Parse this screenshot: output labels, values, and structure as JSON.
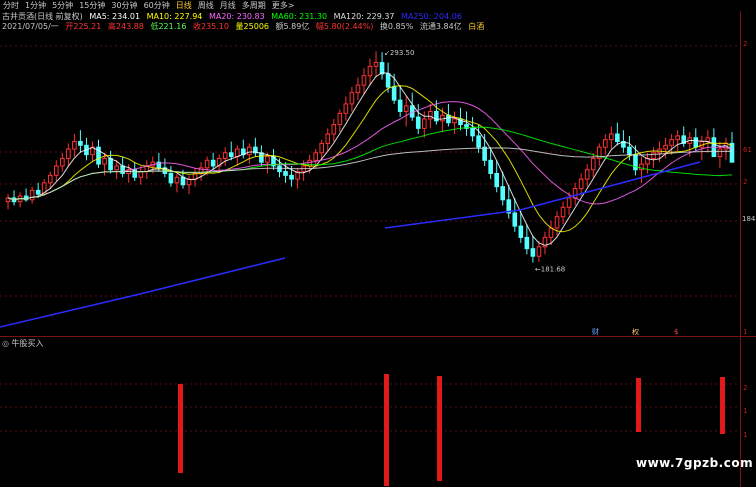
{
  "toolbar": {
    "tabs": [
      "分时",
      "1分钟",
      "5分钟",
      "15分钟",
      "30分钟",
      "60分钟",
      "日线",
      "周线",
      "月线",
      "多周期",
      "更多>"
    ],
    "active_tab": "日线"
  },
  "info": {
    "stock": "古井贡酒(日线 前复权)",
    "ma5": "MA5: 234.01",
    "ma10": "MA10: 227.94",
    "ma20": "MA20: 230.83",
    "ma60": "MA60: 231.30",
    "ma120": "MA120: 229.37",
    "ma250": "MA250: 204.06",
    "date": "2021/07/05/一",
    "open": "开225.21",
    "high": "高243.88",
    "low": "低221.16",
    "close": "收235.10",
    "volume": "量25006",
    "amount": "额5.89亿",
    "change": "幅5.80(2.44%)",
    "turnover": "换0.85%",
    "float": "流通3.84亿",
    "tag": "白酒"
  },
  "annotations": {
    "high_label": "293.50",
    "low_label": "181.68"
  },
  "right_axis": {
    "labels": [
      "2",
      "61",
      "2",
      "184",
      "1"
    ],
    "sub_labels": [
      "2",
      "1",
      "1"
    ]
  },
  "markers": [
    "财",
    "权",
    "$"
  ],
  "sub_panel": {
    "title": "牛股买入"
  },
  "watermark": "www.7gpzb.com",
  "colors": {
    "up": "#ff3232",
    "down": "#54ffff",
    "ma5": "#ffffff",
    "ma10": "#ffff00",
    "ma20": "#ff66ff",
    "ma60": "#00ff00",
    "ma120": "#dddddd",
    "ma250": "#2b2bff",
    "signal": "#e01a1a"
  },
  "chart_data": {
    "type": "candlestick",
    "price_range": [
      175,
      300
    ],
    "candles": [
      [
        214,
        218,
        210,
        216
      ],
      [
        216,
        220,
        212,
        214
      ],
      [
        214,
        219,
        211,
        217
      ],
      [
        217,
        221,
        214,
        215
      ],
      [
        215,
        222,
        213,
        220
      ],
      [
        220,
        224,
        216,
        218
      ],
      [
        218,
        226,
        217,
        224
      ],
      [
        224,
        230,
        221,
        228
      ],
      [
        228,
        236,
        225,
        233
      ],
      [
        233,
        240,
        230,
        237
      ],
      [
        237,
        245,
        233,
        242
      ],
      [
        242,
        250,
        238,
        246
      ],
      [
        246,
        252,
        240,
        244
      ],
      [
        244,
        248,
        236,
        239
      ],
      [
        239,
        246,
        235,
        243
      ],
      [
        243,
        247,
        232,
        234
      ],
      [
        234,
        240,
        228,
        237
      ],
      [
        237,
        241,
        229,
        231
      ],
      [
        231,
        236,
        226,
        233
      ],
      [
        233,
        238,
        227,
        229
      ],
      [
        229,
        234,
        224,
        231
      ],
      [
        231,
        235,
        225,
        227
      ],
      [
        227,
        233,
        223,
        230
      ],
      [
        230,
        236,
        226,
        233
      ],
      [
        233,
        238,
        229,
        235
      ],
      [
        235,
        240,
        230,
        232
      ],
      [
        232,
        237,
        227,
        229
      ],
      [
        229,
        233,
        222,
        224
      ],
      [
        224,
        229,
        219,
        227
      ],
      [
        227,
        231,
        221,
        223
      ],
      [
        223,
        228,
        218,
        226
      ],
      [
        226,
        232,
        222,
        229
      ],
      [
        229,
        235,
        225,
        232
      ],
      [
        232,
        238,
        228,
        236
      ],
      [
        236,
        240,
        231,
        233
      ],
      [
        233,
        239,
        229,
        237
      ],
      [
        237,
        243,
        233,
        240
      ],
      [
        240,
        246,
        236,
        238
      ],
      [
        238,
        244,
        233,
        242
      ],
      [
        242,
        247,
        237,
        239
      ],
      [
        239,
        245,
        234,
        243
      ],
      [
        243,
        248,
        238,
        240
      ],
      [
        240,
        244,
        233,
        235
      ],
      [
        235,
        240,
        229,
        238
      ],
      [
        238,
        242,
        231,
        233
      ],
      [
        233,
        237,
        227,
        230
      ],
      [
        230,
        235,
        224,
        228
      ],
      [
        228,
        233,
        222,
        226
      ],
      [
        226,
        232,
        221,
        230
      ],
      [
        230,
        236,
        225,
        233
      ],
      [
        233,
        239,
        229,
        236
      ],
      [
        236,
        242,
        232,
        240
      ],
      [
        240,
        247,
        236,
        245
      ],
      [
        245,
        253,
        241,
        250
      ],
      [
        250,
        258,
        246,
        255
      ],
      [
        255,
        263,
        251,
        261
      ],
      [
        261,
        270,
        257,
        266
      ],
      [
        266,
        275,
        262,
        272
      ],
      [
        272,
        280,
        268,
        276
      ],
      [
        276,
        285,
        271,
        281
      ],
      [
        281,
        290,
        276,
        286
      ],
      [
        286,
        294,
        280,
        288
      ],
      [
        288,
        293.5,
        279,
        282
      ],
      [
        282,
        288,
        272,
        275
      ],
      [
        275,
        282,
        266,
        268
      ],
      [
        268,
        276,
        259,
        262
      ],
      [
        262,
        270,
        254,
        265
      ],
      [
        265,
        272,
        257,
        259
      ],
      [
        259,
        266,
        250,
        253
      ],
      [
        253,
        262,
        248,
        258
      ],
      [
        258,
        266,
        253,
        262
      ],
      [
        262,
        268,
        255,
        257
      ],
      [
        257,
        264,
        251,
        260
      ],
      [
        260,
        266,
        254,
        256
      ],
      [
        256,
        262,
        250,
        258
      ],
      [
        258,
        264,
        252,
        255
      ],
      [
        255,
        262,
        249,
        253
      ],
      [
        253,
        259,
        246,
        249
      ],
      [
        249,
        255,
        240,
        243
      ],
      [
        243,
        250,
        233,
        236
      ],
      [
        236,
        243,
        226,
        229
      ],
      [
        229,
        236,
        219,
        222
      ],
      [
        222,
        230,
        212,
        215
      ],
      [
        215,
        223,
        205,
        208
      ],
      [
        208,
        216,
        198,
        201
      ],
      [
        201,
        209,
        192,
        195
      ],
      [
        195,
        202,
        186,
        189
      ],
      [
        189,
        196,
        181.68,
        185
      ],
      [
        185,
        193,
        182,
        190
      ],
      [
        190,
        198,
        186,
        195
      ],
      [
        195,
        204,
        191,
        200
      ],
      [
        200,
        209,
        196,
        206
      ],
      [
        206,
        214,
        202,
        211
      ],
      [
        211,
        219,
        207,
        216
      ],
      [
        216,
        224,
        212,
        221
      ],
      [
        221,
        229,
        217,
        226
      ],
      [
        226,
        234,
        222,
        231
      ],
      [
        231,
        240,
        227,
        237
      ],
      [
        237,
        245,
        233,
        243
      ],
      [
        243,
        250,
        239,
        247
      ],
      [
        247,
        254,
        242,
        250
      ],
      [
        250,
        256,
        244,
        246
      ],
      [
        246,
        252,
        240,
        243
      ],
      [
        243,
        249,
        236,
        239
      ],
      [
        239,
        244,
        228,
        231
      ],
      [
        231,
        238,
        224,
        234
      ],
      [
        234,
        240,
        229,
        237
      ],
      [
        237,
        243,
        232,
        240
      ],
      [
        240,
        246,
        235,
        242
      ],
      [
        242,
        248,
        237,
        244
      ],
      [
        244,
        250,
        239,
        247
      ],
      [
        247,
        252,
        241,
        249
      ],
      [
        249,
        254,
        243,
        245
      ],
      [
        245,
        251,
        238,
        248
      ],
      [
        248,
        253,
        241,
        243
      ],
      [
        243,
        249,
        236,
        246
      ],
      [
        246,
        252,
        240,
        248
      ],
      [
        248,
        253,
        240,
        238
      ],
      [
        238,
        246,
        232,
        242
      ],
      [
        242,
        248,
        236,
        245
      ],
      [
        245,
        251,
        240,
        235
      ]
    ],
    "ma_series": [
      "MA5",
      "MA10",
      "MA20",
      "MA60",
      "MA120",
      "MA250"
    ],
    "sub_signal_bars": [
      178,
      384,
      437,
      636,
      720
    ]
  }
}
